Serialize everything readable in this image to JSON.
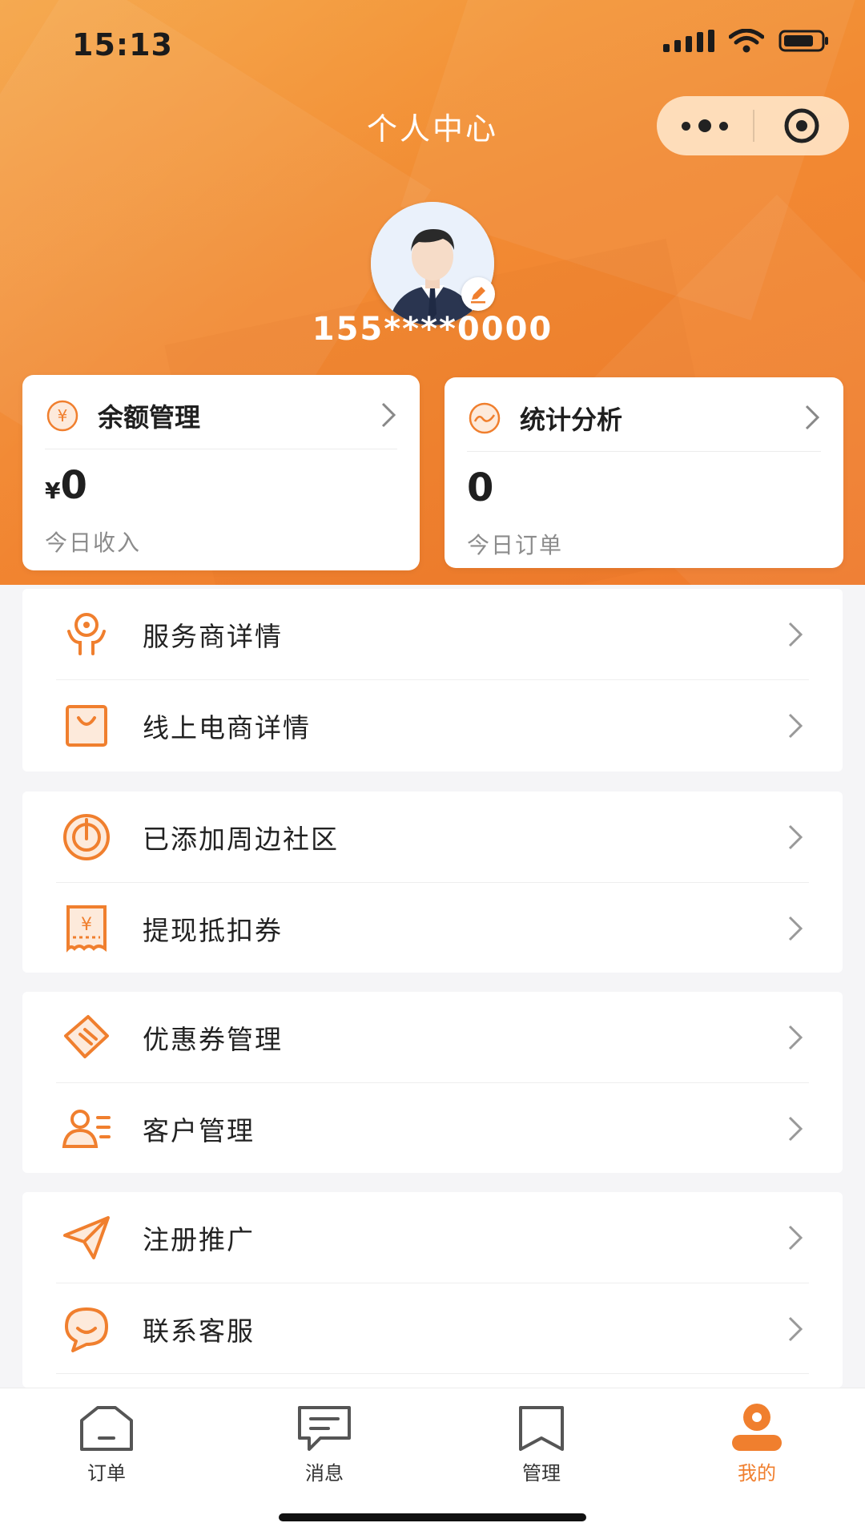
{
  "status_bar": {
    "time": "15:13"
  },
  "nav": {
    "title": "个人中心"
  },
  "profile": {
    "phone": "155****0000"
  },
  "cards": [
    {
      "title": "余额管理",
      "currency": "¥",
      "value": "0",
      "label": "今日收入",
      "icon": "yen-circle-icon"
    },
    {
      "title": "统计分析",
      "value": "0",
      "label": "今日订单",
      "icon": "trend-circle-icon"
    }
  ],
  "menu_groups": [
    [
      {
        "label": "服务商详情",
        "icon": "service-provider-icon"
      },
      {
        "label": "线上电商详情",
        "icon": "shopping-bag-icon"
      }
    ],
    [
      {
        "label": "已添加周边社区",
        "icon": "community-target-icon"
      },
      {
        "label": "提现抵扣券",
        "icon": "withdraw-voucher-icon"
      }
    ],
    [
      {
        "label": "优惠券管理",
        "icon": "coupon-icon"
      },
      {
        "label": "客户管理",
        "icon": "customer-list-icon"
      }
    ],
    [
      {
        "label": "注册推广",
        "icon": "paper-plane-icon"
      },
      {
        "label": "联系客服",
        "icon": "chat-bubble-icon"
      }
    ]
  ],
  "tabbar": [
    {
      "label": "订单",
      "icon": "order-icon",
      "active": false
    },
    {
      "label": "消息",
      "icon": "message-icon",
      "active": false
    },
    {
      "label": "管理",
      "icon": "bookmark-icon",
      "active": false
    },
    {
      "label": "我的",
      "icon": "profile-icon",
      "active": true
    }
  ],
  "colors": {
    "accent": "#f07f2e",
    "hero_top": "#f4a03d",
    "hero_bottom": "#ef7a2c"
  }
}
